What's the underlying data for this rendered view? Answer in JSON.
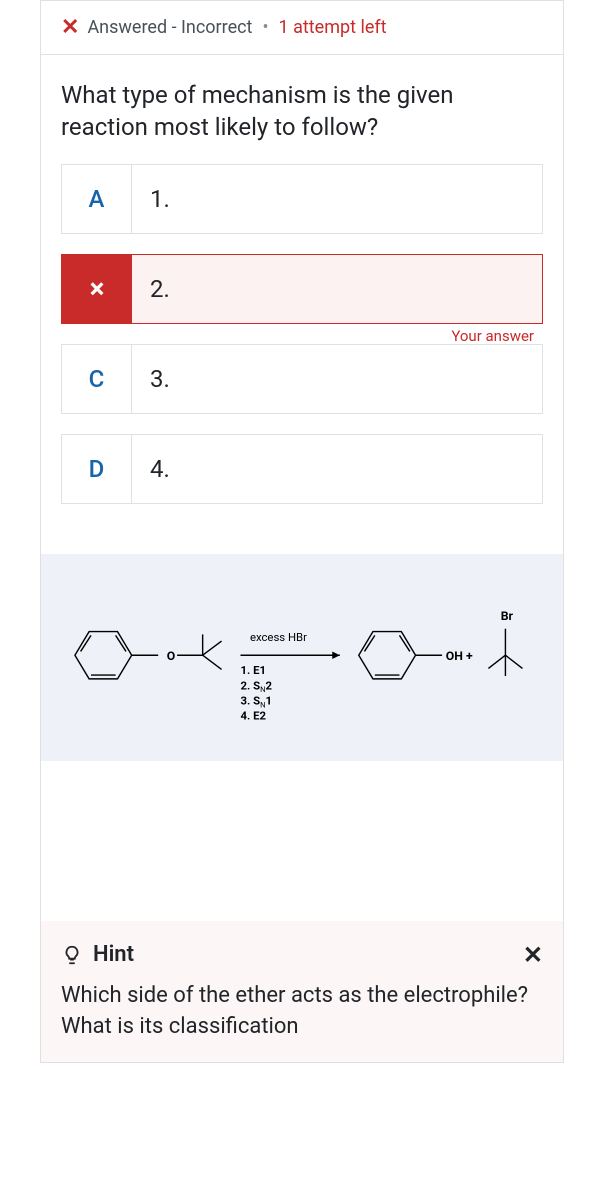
{
  "status": {
    "label": "Answered - Incorrect",
    "attempts": "1 attempt left"
  },
  "question": "What type of mechanism is the given reaction most likely to follow?",
  "options": [
    {
      "letter": "A",
      "text": "1.",
      "state": "default"
    },
    {
      "letter": "×",
      "text": "2.",
      "state": "incorrect",
      "tag": "Your answer"
    },
    {
      "letter": "C",
      "text": "3.",
      "state": "default"
    },
    {
      "letter": "D",
      "text": "4.",
      "state": "default"
    }
  ],
  "diagram": {
    "reagent": "excess HBr",
    "mech1": "1. E1",
    "mech2_prefix": "2. S",
    "mech2_suffix": "2",
    "mech3_prefix": "3. S",
    "mech3_suffix": "1",
    "mech4": "4. E2",
    "product_mid": "OH +",
    "product_br": "Br",
    "sub_n": "N",
    "atom_o": "O"
  },
  "hint": {
    "title": "Hint",
    "text": "Which side of the ether acts as the electrophile? What is its classification"
  }
}
